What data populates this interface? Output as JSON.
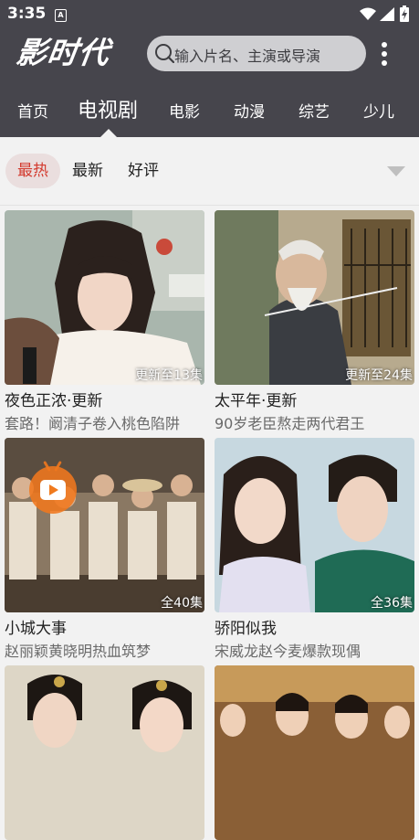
{
  "status": {
    "time": "3:35",
    "notif_icon": "A"
  },
  "header": {
    "logo_text": "影时代",
    "search_placeholder": "输入片名、主演或导演"
  },
  "nav_tabs": [
    {
      "label": "首页",
      "active": false
    },
    {
      "label": "电视剧",
      "active": true
    },
    {
      "label": "电影",
      "active": false
    },
    {
      "label": "动漫",
      "active": false
    },
    {
      "label": "综艺",
      "active": false
    },
    {
      "label": "少儿",
      "active": false
    }
  ],
  "filters": [
    {
      "label": "最热",
      "active": true
    },
    {
      "label": "最新",
      "active": false
    },
    {
      "label": "好评",
      "active": false
    }
  ],
  "cards": [
    {
      "title": "夜色正浓·更新",
      "subtitle": "套路！阚清子卷入桃色陷阱",
      "badge": "更新至13集"
    },
    {
      "title": "太平年·更新",
      "subtitle": "90岁老臣熬走两代君王",
      "badge": "更新至24集"
    },
    {
      "title": "小城大事",
      "subtitle": "赵丽颖黄晓明热血筑梦",
      "badge": "全40集"
    },
    {
      "title": "骄阳似我",
      "subtitle": "宋威龙赵今麦爆款现偶",
      "badge": "全36集"
    },
    {
      "title": "",
      "subtitle": "",
      "badge": ""
    },
    {
      "title": "",
      "subtitle": "",
      "badge": ""
    }
  ],
  "colors": {
    "header_bg": "#46454c",
    "accent": "#d33b2f",
    "page_bg": "#f2f2f2",
    "fab": "#f07a1e"
  }
}
